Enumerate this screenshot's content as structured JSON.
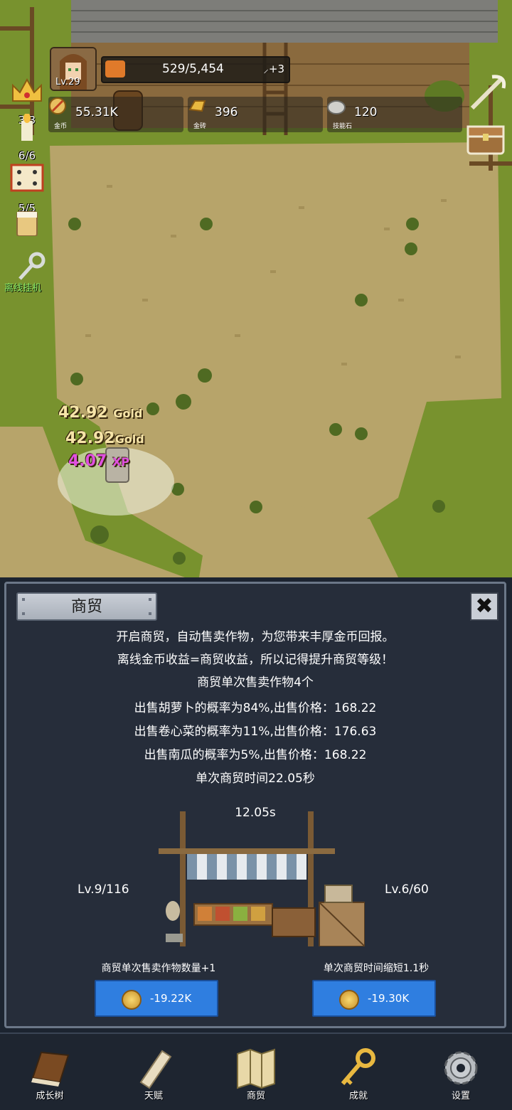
{
  "player": {
    "level": "Lv.29",
    "xp_text": "529/5,454",
    "xp_bonus": "+3"
  },
  "resources": [
    {
      "value": "55.31K",
      "caption": "金币",
      "icon": "gold-coin-icon"
    },
    {
      "value": "396",
      "caption": "金砖",
      "icon": "gold-bar-icon"
    },
    {
      "value": "120",
      "caption": "技能石",
      "icon": "skill-stone-icon"
    }
  ],
  "side_counters": [
    "3/3",
    "6/6",
    "5/5"
  ],
  "offline_label": "离线挂机",
  "floating": {
    "gold1": "42.92",
    "gold_word": "Gold",
    "gold2": "42.92",
    "xp_value": "4.07",
    "xp_word": "XP"
  },
  "panel": {
    "title": "商贸",
    "close_symbol": "✖",
    "lines": [
      "开启商贸，自动售卖作物，为您带来丰厚金币回报。",
      "离线金币收益=商贸收益，所以记得提升商贸等级！",
      "商贸单次售卖作物4个",
      "出售胡萝卜的概率为84%,出售价格：168.22",
      "出售卷心菜的概率为11%,出售价格：176.63",
      "出售南瓜的概率为5%,出售价格：168.22",
      "单次商贸时间22.05秒"
    ],
    "timer": "12.05s",
    "left_level": "Lv.9/116",
    "right_level": "Lv.6/60",
    "left_upgrade_label": "商贸单次售卖作物数量+1",
    "right_upgrade_label": "单次商贸时间缩短1.1秒",
    "left_cost": "-19.22K",
    "right_cost": "-19.30K"
  },
  "nav": [
    {
      "label": "成长树",
      "icon": "book-icon"
    },
    {
      "label": "天赋",
      "icon": "scroll-icon"
    },
    {
      "label": "商贸",
      "icon": "map-icon"
    },
    {
      "label": "成就",
      "icon": "key-icon"
    },
    {
      "label": "设置",
      "icon": "gear-icon"
    }
  ],
  "colors": {
    "upgrade_button": "#2f7ee0",
    "panel_bg": "#262d3a",
    "offline_text": "#8cf06a",
    "xp_float": "#e050e0",
    "gold_float": "#f6e4a8"
  }
}
